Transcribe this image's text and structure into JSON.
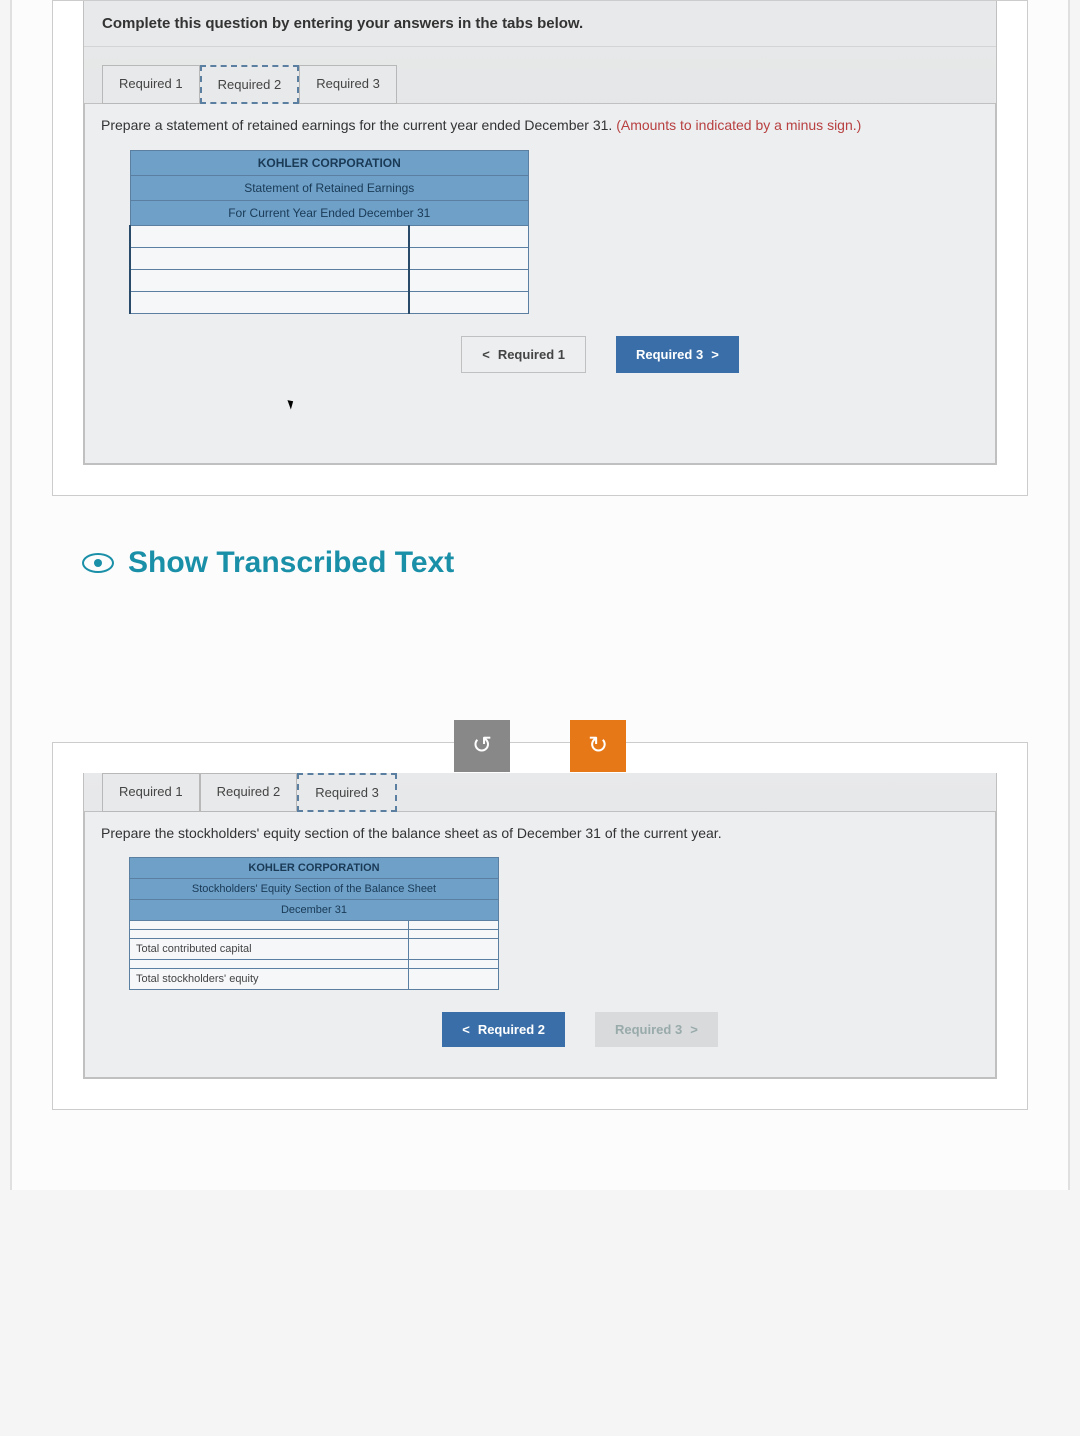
{
  "card1": {
    "instruction": "Complete this question by entering your answers in the tabs below.",
    "tabs": [
      "Required 1",
      "Required 2",
      "Required 3"
    ],
    "active_tab_index": 1,
    "prompt": "Prepare a statement of retained earnings for the current year ended December 31. ",
    "hint": "(Amounts to indicated by a minus sign.)",
    "table": {
      "title": "KOHLER CORPORATION",
      "subtitle1": "Statement of Retained Earnings",
      "subtitle2": "For Current Year Ended December 31"
    },
    "nav_prev": "Required 1",
    "nav_next": "Required 3"
  },
  "show_transcribed": "Show Transcribed Text",
  "card2": {
    "tabs": [
      "Required 1",
      "Required 2",
      "Required 3"
    ],
    "active_tab_index": 2,
    "prompt": "Prepare the stockholders' equity section of the balance sheet as of December 31 of the current year.",
    "table": {
      "title": "KOHLER CORPORATION",
      "subtitle1": "Stockholders' Equity Section of the Balance Sheet",
      "subtitle2": "December 31",
      "rows": [
        "Total contributed capital",
        "Total stockholders' equity"
      ]
    },
    "nav_prev": "Required 2",
    "nav_next": "Required 3"
  }
}
